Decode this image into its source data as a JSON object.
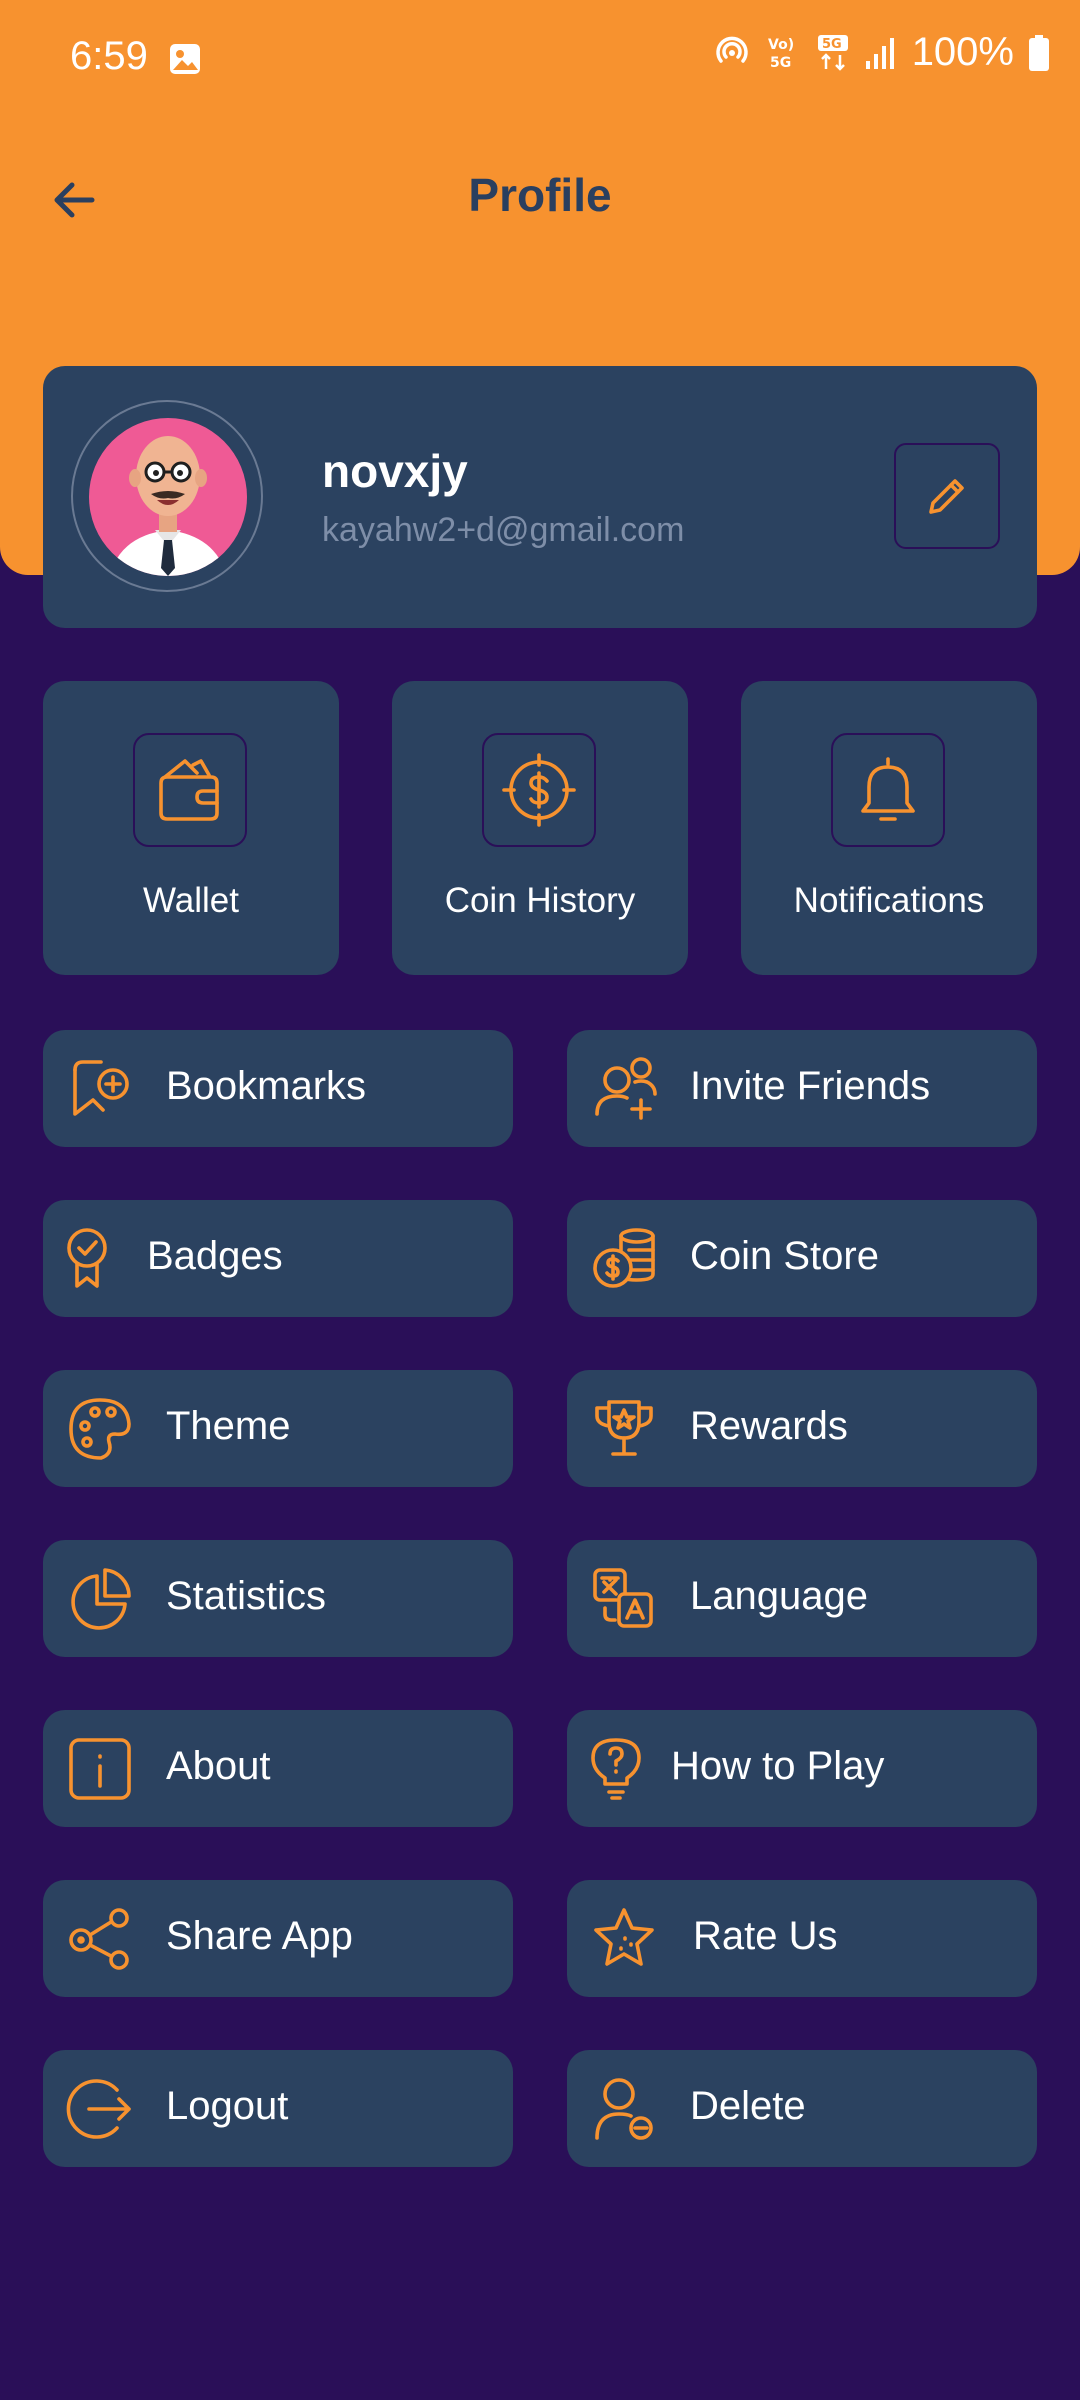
{
  "status_bar": {
    "time": "6:59",
    "battery": "100%"
  },
  "header": {
    "title": "Profile"
  },
  "profile": {
    "name": "novxjy",
    "email": "kayahw2+d@gmail.com"
  },
  "tiles": [
    {
      "label": "Wallet",
      "icon": "wallet-icon"
    },
    {
      "label": "Coin History",
      "icon": "coin-history-icon"
    },
    {
      "label": "Notifications",
      "icon": "bell-icon"
    }
  ],
  "menu": {
    "bookmarks": "Bookmarks",
    "invite_friends": "Invite Friends",
    "badges": "Badges",
    "coin_store": "Coin Store",
    "theme": "Theme",
    "rewards": "Rewards",
    "statistics": "Statistics",
    "language": "Language",
    "about": "About",
    "how_to_play": "How to Play",
    "share_app": "Share App",
    "rate_us": "Rate Us",
    "logout": "Logout",
    "delete": "Delete"
  },
  "colors": {
    "header_orange": "#F7922F",
    "background_purple": "#2A0F58",
    "card_navy": "#2B4260",
    "title_navy": "#2A3F5F",
    "email_gray": "#7E8EA8"
  }
}
